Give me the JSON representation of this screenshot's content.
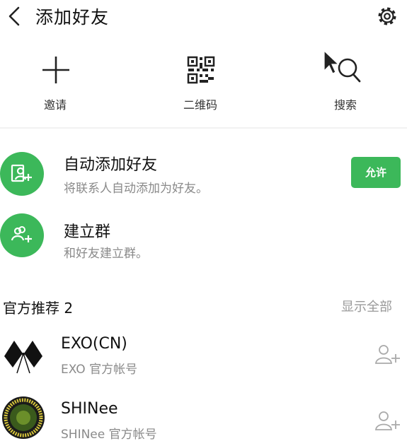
{
  "header": {
    "title": "添加好友",
    "back_icon": "chevron-left-icon",
    "settings_icon": "gear-icon"
  },
  "quick_actions": [
    {
      "label": "邀请",
      "icon": "plus-icon"
    },
    {
      "label": "二维码",
      "icon": "qr-code-icon"
    },
    {
      "label": "搜索",
      "icon": "search-icon"
    }
  ],
  "auto_add": {
    "title": "自动添加好友",
    "subtitle": "将联系人自动添加为好友。",
    "button_label": "允许",
    "icon": "user-add-icon"
  },
  "create_group": {
    "title": "建立群",
    "subtitle": "和好友建立群。",
    "icon": "group-add-icon"
  },
  "official": {
    "section_title": "官方推荐 2",
    "show_all_label": "显示全部",
    "accounts": [
      {
        "name": "EXO(CN)",
        "desc": "EXO 官方帐号",
        "icon": "exo-logo"
      },
      {
        "name": "SHINee",
        "desc": "SHINee 官方帐号",
        "icon": "shinee-logo"
      }
    ]
  },
  "colors": {
    "accent": "#3cb85a",
    "text_primary": "#111111",
    "text_secondary": "#8a8a8a"
  }
}
